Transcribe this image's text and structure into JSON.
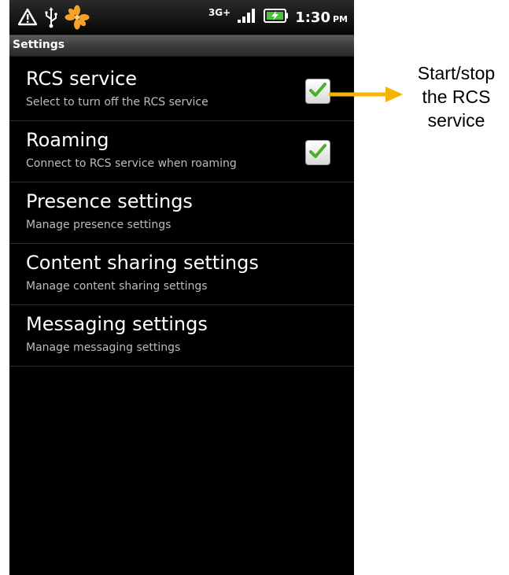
{
  "status_bar": {
    "icons": [
      "warning-icon",
      "usb-icon",
      "pinwheel-app-icon",
      "signal-icon",
      "battery-charging-icon"
    ],
    "network": "3G+",
    "time": "1:30",
    "ampm": "PM"
  },
  "title_bar": {
    "title": "Settings"
  },
  "preferences": [
    {
      "title": "RCS service",
      "summary": "Select to turn off the RCS service",
      "checked": true
    },
    {
      "title": "Roaming",
      "summary": "Connect to RCS service when roaming",
      "checked": true
    },
    {
      "title": "Presence settings",
      "summary": "Manage presence settings"
    },
    {
      "title": "Content sharing settings",
      "summary": "Manage content sharing settings"
    },
    {
      "title": "Messaging settings",
      "summary": "Manage messaging settings"
    }
  ],
  "annotation": {
    "text": "Start/stop\nthe RCS\nservice",
    "arrow_color": "#f5b400"
  },
  "colors": {
    "checkmark": "#4caf2a",
    "screen_bg": "#000000",
    "summary_text": "#bdbdbd"
  }
}
